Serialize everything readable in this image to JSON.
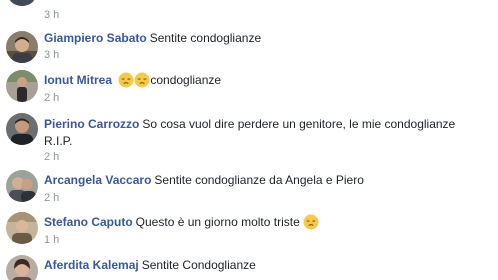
{
  "comments": [
    {
      "author": "",
      "text": "",
      "time": "3 h"
    },
    {
      "author": "Giampiero Sabato",
      "text": "Sentite condoglianze",
      "time": "3 h"
    },
    {
      "author": "Ionut Mitrea",
      "text": "condoglianze",
      "time": "2 h",
      "emojis": [
        "pensive-face",
        "pensive-face"
      ]
    },
    {
      "author": "Pierino Carrozzo",
      "text": "So cosa vuol dire perdere un genitore, le mie condoglianze",
      "text_cont": "R.I.P.",
      "time": "2 h"
    },
    {
      "author": "Arcangela Vaccaro",
      "text": "Sentite condoglianze da Angela e Piero",
      "time": "2 h"
    },
    {
      "author": "Stefano Caputo",
      "text": "Questo è un giorno molto triste",
      "time": "1 h",
      "emojis": [
        "pensive-face"
      ]
    },
    {
      "author": "Aferdita Kalemaj",
      "text": "Sentite Condoglianze",
      "time": ""
    }
  ],
  "colors": {
    "author_link": "#385898",
    "body_text": "#1d2129",
    "timestamp": "#90949c",
    "emoji_face": "#f7c94a"
  }
}
